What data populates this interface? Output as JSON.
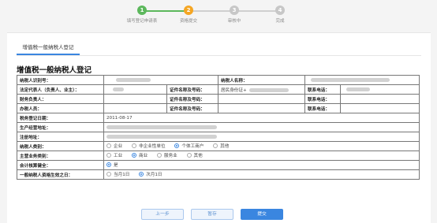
{
  "stepper": {
    "steps": [
      {
        "num": "1",
        "label": "填写登记申请表",
        "state": "done"
      },
      {
        "num": "2",
        "label": "资格提交",
        "state": "active"
      },
      {
        "num": "3",
        "label": "审核中",
        "state": "todo"
      },
      {
        "num": "4",
        "label": "完成",
        "state": "todo"
      }
    ]
  },
  "tab": {
    "label": "增值税一般纳税人登记"
  },
  "form": {
    "title": "增值税一般纳税人登记",
    "labels": {
      "taxpayer_id": "纳税人识别号：",
      "taxpayer_name": "纳税人名称：",
      "legal_rep": "法定代表人（负责人、业主）：",
      "id_doc": "证件名称及号码：",
      "phone": "联系电话：",
      "finance_head": "财务负责人：",
      "tax_officer": "办税人员：",
      "reg_date": "税务登记日期：",
      "biz_address": "生产经营地址：",
      "reg_address": "注册地址：",
      "taxpayer_type": "纳税人类别：",
      "main_business": "主营业务类别：",
      "accounting_sound": "会计核算健全：",
      "effective_date": "一般纳税人资格生效之日："
    },
    "values": {
      "reg_date": "2011-08-17",
      "legal_id_doc": "居民身份证+"
    },
    "taxpayer_type_options": [
      "企业",
      "非企业性单位",
      "个体工商户",
      "其他"
    ],
    "taxpayer_type_selected": 2,
    "main_business_options": [
      "工业",
      "商业",
      "服务业",
      "其他"
    ],
    "main_business_selected": 1,
    "accounting_options": [
      "是"
    ],
    "accounting_selected": 0,
    "effective_options": [
      "当月1日",
      "次月1日"
    ],
    "effective_selected": 1
  },
  "buttons": {
    "prev": "上一步",
    "save": "暂存",
    "submit": "提交"
  },
  "colors": {
    "done": "#5cb85c",
    "active": "#f5a623",
    "todo": "#c7c7c7",
    "accent": "#3a86e0"
  }
}
